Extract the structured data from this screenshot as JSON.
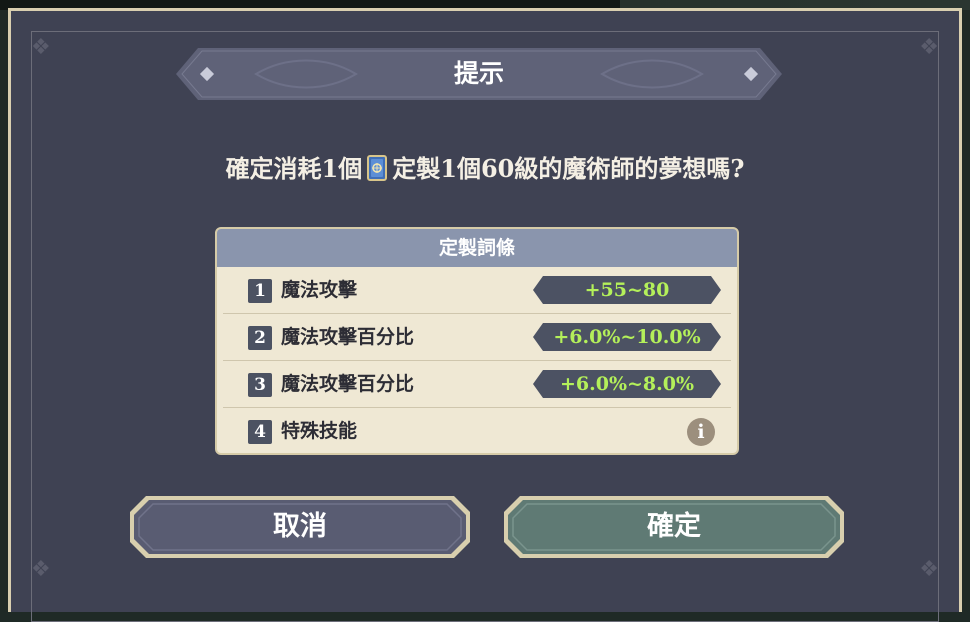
{
  "dialog": {
    "title": "提示",
    "prompt_prefix": "確定消耗1個",
    "prompt_item_icon": "magic-book-icon",
    "prompt_suffix": "定製1個60級的魔術師的夢想嗎?"
  },
  "panel": {
    "header": "定製詞條",
    "rows": [
      {
        "num": "1",
        "label": "魔法攻擊",
        "value": "+55~80"
      },
      {
        "num": "2",
        "label": "魔法攻擊百分比",
        "value": "+6.0%~10.0%"
      },
      {
        "num": "3",
        "label": "魔法攻擊百分比",
        "value": "+6.0%~8.0%"
      },
      {
        "num": "4",
        "label": "特殊技能",
        "icon": "info-icon",
        "icon_glyph": "i"
      }
    ]
  },
  "buttons": {
    "cancel_label": "取消",
    "confirm_label": "確定"
  },
  "colors": {
    "dialog_bg": "#3f4253",
    "frame": "#d9cfb0",
    "value_text": "#b4f05a",
    "confirm_bg": "#5f7a74",
    "cancel_bg": "#595c72"
  }
}
